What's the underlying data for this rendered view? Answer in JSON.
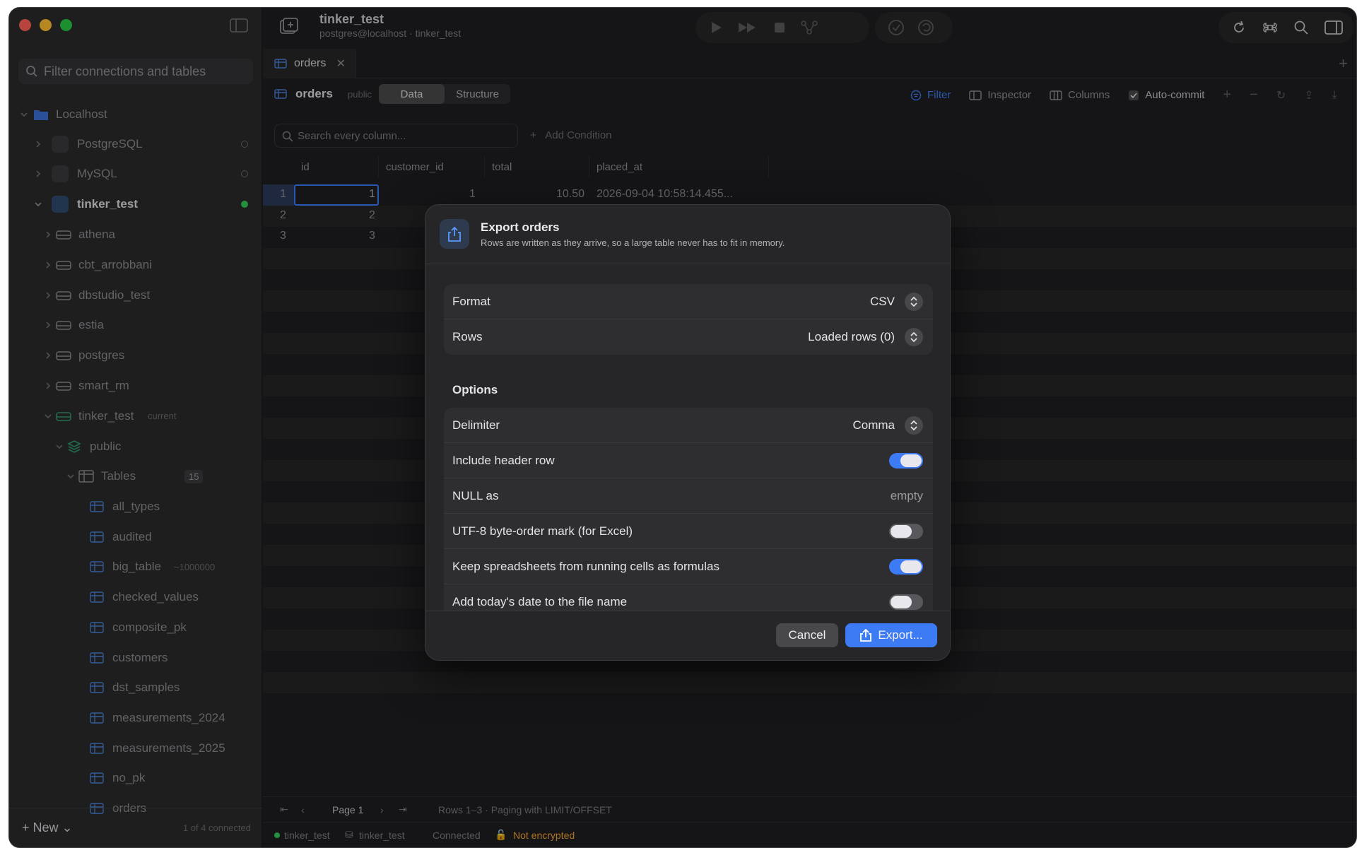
{
  "sidebar": {
    "filter_placeholder": "Filter connections and tables",
    "root": "Localhost",
    "connections": [
      {
        "label": "PostgreSQL",
        "status": "offline"
      },
      {
        "label": "MySQL",
        "status": "offline"
      },
      {
        "label": "tinker_test",
        "status": "online"
      }
    ],
    "databases": [
      "athena",
      "cbt_arrobbani",
      "dbstudio_test",
      "estia",
      "postgres",
      "smart_rm",
      "tinker_test"
    ],
    "current_badge": "current",
    "schema": "public",
    "tables_label": "Tables",
    "tables_count": "15",
    "tables": [
      "all_types",
      "audited",
      "big_table",
      "checked_values",
      "composite_pk",
      "customers",
      "dst_samples",
      "measurements_2024",
      "measurements_2025",
      "no_pk",
      "orders"
    ],
    "big_table_count": "~1000000",
    "new_label": "New",
    "connected_count": "1 of 4 connected"
  },
  "toolbar": {
    "title": "tinker_test",
    "subtitle": "postgres@localhost · tinker_test"
  },
  "tab": {
    "label": "orders"
  },
  "table_header": {
    "name": "orders",
    "schema": "public",
    "seg_data": "Data",
    "seg_structure": "Structure",
    "filter": "Filter",
    "inspector": "Inspector",
    "columns": "Columns",
    "autocommit": "Auto-commit"
  },
  "search": {
    "placeholder": "Search every column...",
    "add_condition": "Add Condition"
  },
  "grid": {
    "columns": [
      "id",
      "customer_id",
      "total",
      "placed_at"
    ],
    "rows": [
      {
        "n": "1",
        "id": "1",
        "customer_id": "1",
        "total": "10.50",
        "placed_at": "2026-09-04 10:58:14.455..."
      },
      {
        "n": "2",
        "id": "2"
      },
      {
        "n": "3",
        "id": "3"
      }
    ]
  },
  "pager": {
    "page": "Page 1",
    "info": "Rows 1–3 · Paging with LIMIT/OFFSET"
  },
  "status": {
    "conn": "tinker_test",
    "db": "tinker_test",
    "state": "Connected",
    "enc": "Not encrypted"
  },
  "dialog": {
    "title": "Export orders",
    "subtitle": "Rows are written as they arrive, so a large table never has to fit in memory.",
    "format_label": "Format",
    "format_value": "CSV",
    "rows_label": "Rows",
    "rows_value": "Loaded rows (0)",
    "options_heading": "Options",
    "delimiter_label": "Delimiter",
    "delimiter_value": "Comma",
    "header_row_label": "Include header row",
    "null_label": "NULL as",
    "null_value": "empty",
    "bom_label": "UTF-8 byte-order mark (for Excel)",
    "formulas_label": "Keep spreadsheets from running cells as formulas",
    "date_label": "Add today's date to the file name",
    "cancel": "Cancel",
    "export": "Export..."
  },
  "colors": {
    "accent": "#3d7bf5",
    "online": "#34c759",
    "warning": "#f0a030"
  }
}
